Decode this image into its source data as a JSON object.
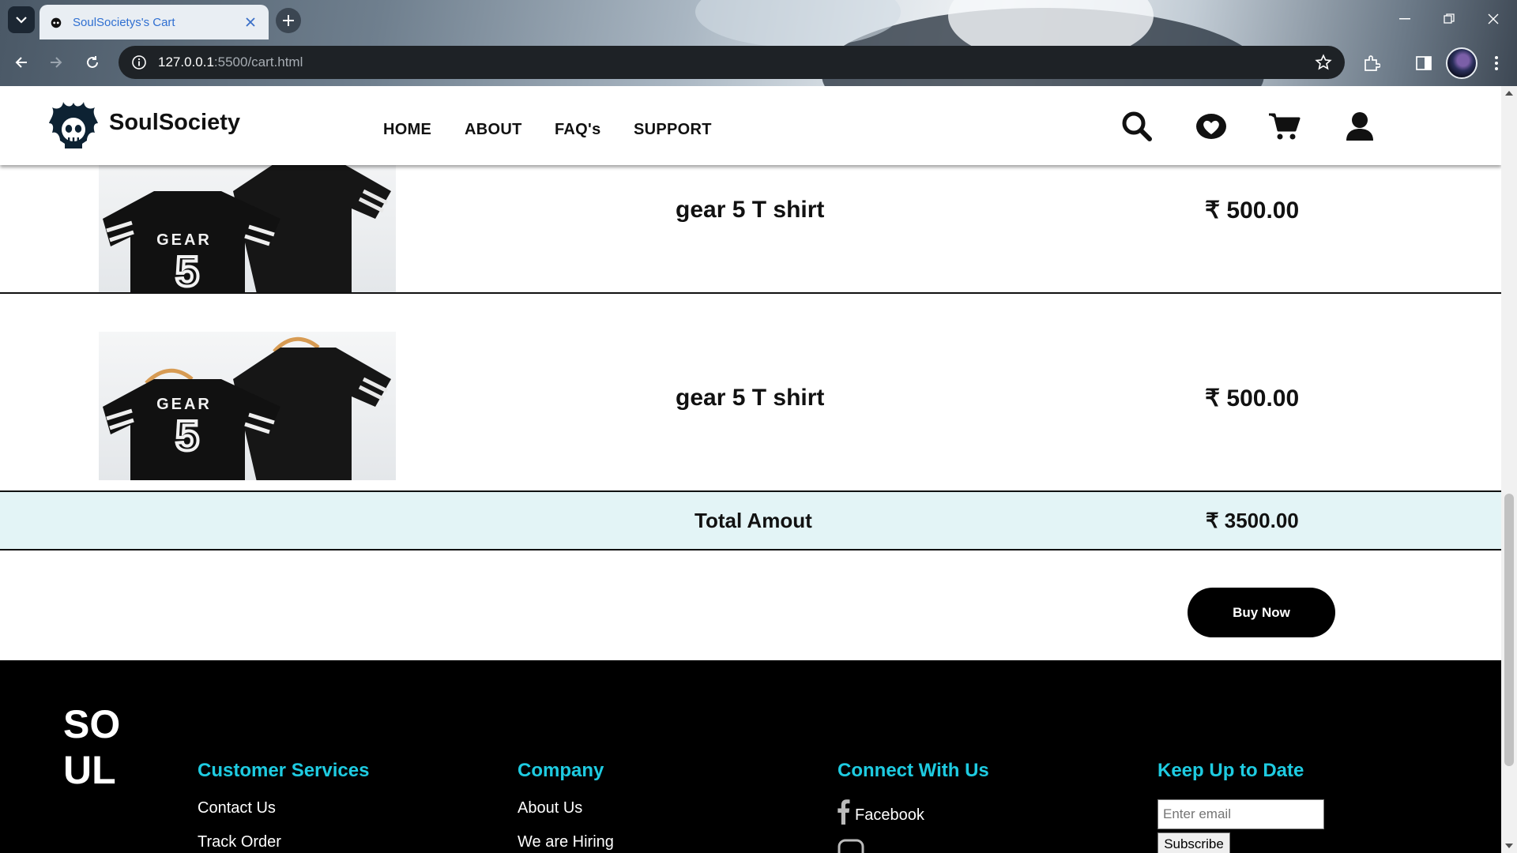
{
  "browser": {
    "tab_title": "SoulSocietys's Cart",
    "url_host": "127.0.0.1",
    "url_rest": ":5500/cart.html"
  },
  "header": {
    "brand": "SoulSociety",
    "nav": [
      "HOME",
      "ABOUT",
      "FAQ's",
      "SUPPORT"
    ],
    "icons": [
      "search-icon",
      "heart-icon",
      "cart-icon",
      "user-icon"
    ]
  },
  "cart": {
    "items": [
      {
        "name": "gear 5 T shirt",
        "price": "₹ 500.00",
        "image": "gear-5-tshirt-image"
      },
      {
        "name": "gear 5 T shirt",
        "price": "₹ 500.00",
        "image": "gear-5-tshirt-image"
      }
    ],
    "total_label": "Total Amout",
    "total_value": "₹ 3500.00",
    "buy_label": "Buy Now"
  },
  "footer": {
    "logo_alt": "SOUL SOCIETY",
    "customer_services": {
      "title": "Customer Services",
      "links": [
        "Contact Us",
        "Track Order"
      ]
    },
    "company": {
      "title": "Company",
      "links": [
        "About Us",
        "We are Hiring"
      ]
    },
    "connect": {
      "title": "Connect With Us",
      "links": [
        "Facebook"
      ]
    },
    "newsletter": {
      "title": "Keep Up to Date",
      "placeholder": "Enter email",
      "button": "Subscribe"
    }
  },
  "colors": {
    "accent": "#1ecbe1",
    "total_bg": "#e3f4f6",
    "footer_bg": "#000000"
  }
}
